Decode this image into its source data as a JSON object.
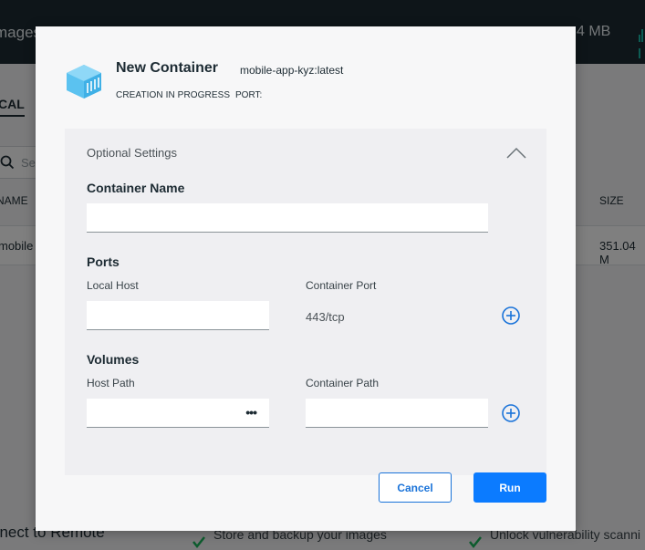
{
  "background": {
    "header_title": "mages",
    "header_size": "4 MB",
    "tab_local": "CAL",
    "search_placeholder": "Se",
    "column_name": "NAME",
    "column_size": "SIZE",
    "row_name": "mobile",
    "row_size": "351.04 M",
    "bottom_connect": "nnect to Remote",
    "bottom_store": "Store and backup your images",
    "bottom_unlock": "Unlock vulnerability scanni"
  },
  "dialog": {
    "title": "New Container",
    "image": "mobile-app-kyz:latest",
    "status": "CREATION IN PROGRESS",
    "port_label": "PORT:",
    "optional_settings": "Optional Settings",
    "container_name": {
      "label": "Container Name",
      "value": "",
      "placeholder": ""
    },
    "ports": {
      "title": "Ports",
      "local_host_label": "Local Host",
      "local_host_value": "",
      "container_port_label": "Container Port",
      "container_port_value": "443/tcp"
    },
    "volumes": {
      "title": "Volumes",
      "host_path_label": "Host Path",
      "host_path_value": "",
      "browse_label": "•••",
      "container_path_label": "Container Path",
      "container_path_value": ""
    },
    "cancel_label": "Cancel",
    "run_label": "Run"
  },
  "colors": {
    "primary": "#0b7bff",
    "header_bg": "#1d2b33",
    "docker_icon": "#5bc2f0"
  }
}
